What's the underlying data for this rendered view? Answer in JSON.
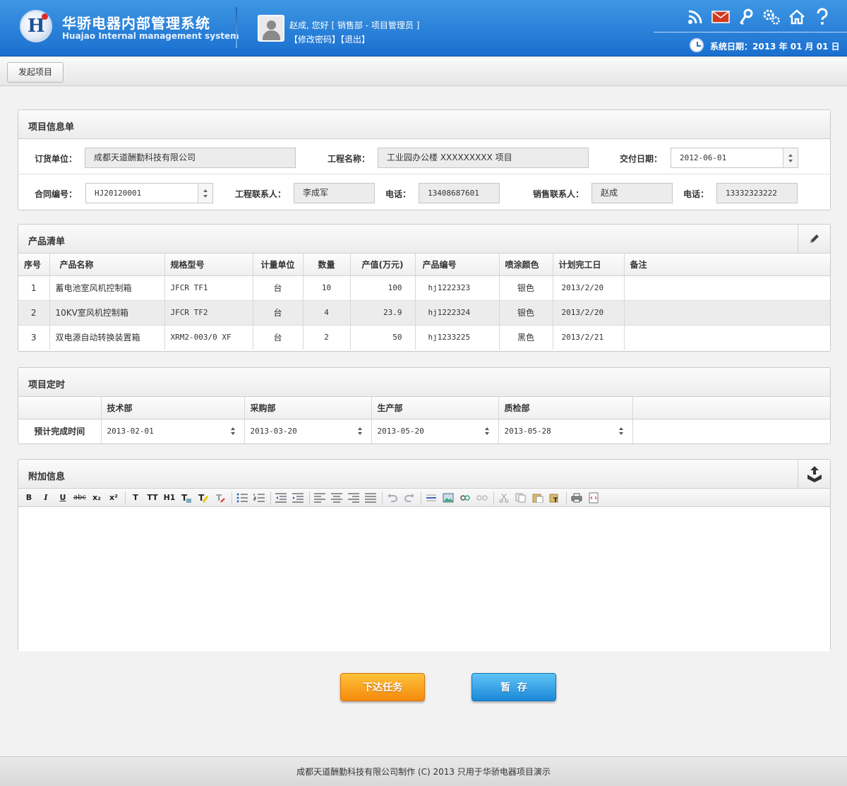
{
  "header": {
    "title_cn": "华骄电器内部管理系统",
    "title_en": "Huajao Internal management system",
    "greeting": "赵成, 您好 [ 销售部 - 项目管理员 ]",
    "change_password": "【修改密码】",
    "logout": "【退出】",
    "system_date": "系统日期：2013 年 01 月 01 日",
    "icons": [
      "rss-icon",
      "mail-icon",
      "key-icon",
      "settings-icon",
      "home-icon",
      "help-icon"
    ]
  },
  "tabs": [
    "发起项目"
  ],
  "project_info": {
    "title": "项目信息单",
    "order_unit_label": "订货单位：",
    "order_unit": "成都天道酬勤科技有限公司",
    "project_name_label": "工程名称：",
    "project_name": "工业园办公楼 XXXXXXXXX 项目",
    "delivery_date_label": "交付日期：",
    "delivery_date": "2012-06-01",
    "contract_no_label": "合同编号：",
    "contract_no": "HJ20120001",
    "project_contact_label": "工程联系人：",
    "project_contact": "李成军",
    "phone_label": "电话：",
    "project_phone": "13408687601",
    "sales_contact_label": "销售联系人：",
    "sales_contact": "赵成",
    "sales_phone": "13332323222"
  },
  "products": {
    "title": "产品清单",
    "columns": [
      "序号",
      "产品名称",
      "规格型号",
      "计量单位",
      "数量",
      "产值(万元)",
      "产品编号",
      "喷涂颜色",
      "计划完工日",
      "备注"
    ],
    "rows": [
      {
        "no": "1",
        "name": "蓄电池室风机控制箱",
        "spec": "JFCR TF1",
        "unit": "台",
        "qty": "10",
        "value": "100",
        "code": "hj1222323",
        "color": "银色",
        "finish": "2013/2/20",
        "note": ""
      },
      {
        "no": "2",
        "name": "10KV室风机控制箱",
        "spec": "JFCR TF2",
        "unit": "台",
        "qty": "4",
        "value": "23.9",
        "code": "hj1222324",
        "color": "银色",
        "finish": "2013/2/20",
        "note": ""
      },
      {
        "no": "3",
        "name": "双电源自动转换装置箱",
        "spec": "XRM2-003/0 XF",
        "unit": "台",
        "qty": "2",
        "value": "50",
        "code": "hj1233225",
        "color": "黑色",
        "finish": "2013/2/21",
        "note": ""
      }
    ]
  },
  "schedule": {
    "title": "项目定时",
    "columns": [
      "",
      "技术部",
      "采购部",
      "生产部",
      "质检部",
      ""
    ],
    "row_label": "预计完成时间",
    "dates": [
      "2013-02-01",
      "2013-03-20",
      "2013-05-20",
      "2013-05-28"
    ]
  },
  "extra": {
    "title": "附加信息",
    "toolbar": [
      "B",
      "I",
      "U",
      "abc",
      "x₂",
      "x²",
      "T",
      "TT",
      "H1"
    ]
  },
  "actions": {
    "submit": "下达任务",
    "save": "暂  存"
  },
  "footer": "成都天道酬勤科技有限公司制作 (C) 2013 只用于华骄电器项目演示",
  "colors": {
    "header_blue": "#1a6fcf",
    "submit_orange": "#f58a0c",
    "save_blue": "#1b88d8"
  }
}
